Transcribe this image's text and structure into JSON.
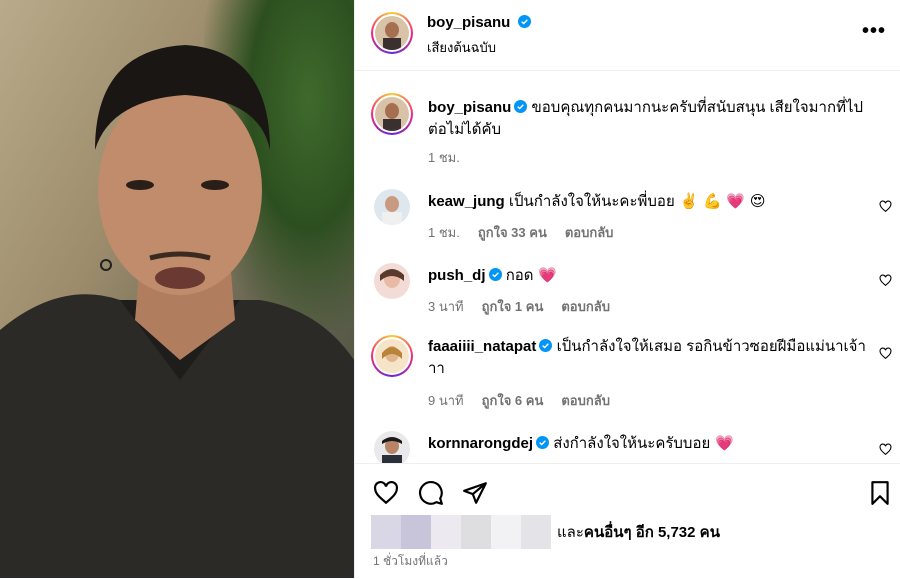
{
  "header": {
    "username": "boy_pisanu",
    "subtitle": "เสียงต้นฉบับ",
    "more_icon": "more-horizontal-icon"
  },
  "caption": {
    "username": "boy_pisanu",
    "text": "ขอบคุณทุกคนมากนะครับที่สนับสนุน เสียใจมากที่ไปต่อไม่ได้คับ",
    "time": "1 ชม."
  },
  "comments": [
    {
      "username": "keaw_jung",
      "verified": false,
      "text": "เป็นกำลังใจให้นะคะพี่บอย ✌️ 💪 💗 😍",
      "time": "1 ชม.",
      "likes": "ถูกใจ 33 คน",
      "reply": "ตอบกลับ"
    },
    {
      "username": "push_dj",
      "verified": true,
      "text": "กอด 💗",
      "time": "3 นาที",
      "likes": "ถูกใจ 1 คน",
      "reply": "ตอบกลับ"
    },
    {
      "username": "faaaiiii_natapat",
      "verified": true,
      "text": "เป็นกำลังใจให้เสมอ รอกินข้าวซอยฝีมือแม่นาเจ้าาา",
      "time": "9 นาที",
      "likes": "ถูกใจ 6 คน",
      "reply": "ตอบกลับ"
    },
    {
      "username": "kornnarongdej",
      "verified": true,
      "text": "ส่งกำลังใจให้นะครับบอย 💗"
    }
  ],
  "footer": {
    "likes_prefix": "และ",
    "likes_text": "คนอื่นๆ อีก 5,732 คน",
    "time": "1 ชั่วโมงที่แล้ว"
  },
  "colors": {
    "verified": "#0095f6",
    "meta": "#737373",
    "heart": "#ff3040"
  }
}
